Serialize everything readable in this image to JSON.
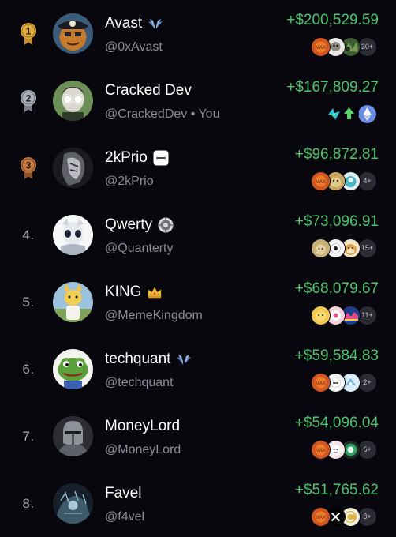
{
  "leaderboard": {
    "rows": [
      {
        "rank": "1",
        "medal": "gold",
        "name": "Avast",
        "badge": "wings-icon",
        "handle": "@0xAvast",
        "pnl": "+$200,529.59",
        "tokens": [
          "orange",
          "white",
          "camo"
        ],
        "more": "30+"
      },
      {
        "rank": "2",
        "medal": "silver",
        "name": "Cracked Dev",
        "badge": "",
        "handle": "@CrackedDev • You",
        "pnl": "+$167,809.27",
        "tokens": [
          "cyan",
          "green-arrow",
          "ethereum"
        ],
        "more": ""
      },
      {
        "rank": "3",
        "medal": "bronze",
        "name": "2kPrio",
        "badge": "white-card-icon",
        "handle": "@2kPrio",
        "pnl": "+$96,872.81",
        "tokens": [
          "orange",
          "tan",
          "teal"
        ],
        "more": "4+"
      },
      {
        "rank": "4.",
        "medal": "",
        "name": "Qwerty",
        "badge": "gear-badge-icon",
        "handle": "@Quanterty",
        "pnl": "+$73,096.91",
        "tokens": [
          "tan",
          "white",
          "doge"
        ],
        "more": "15+"
      },
      {
        "rank": "5.",
        "medal": "",
        "name": "KING",
        "badge": "crown-icon",
        "handle": "@MemeKingdom",
        "pnl": "+$68,079.67",
        "tokens": [
          "yellow",
          "pink",
          "rainbow"
        ],
        "more": "11+"
      },
      {
        "rank": "6.",
        "medal": "",
        "name": "techquant",
        "badge": "wings-icon",
        "handle": "@techquant",
        "pnl": "+$59,584.83",
        "tokens": [
          "orange",
          "white",
          "lightblue"
        ],
        "more": "2+"
      },
      {
        "rank": "7.",
        "medal": "",
        "name": "MoneyLord",
        "badge": "",
        "handle": "@MoneyLord",
        "pnl": "+$54,096.04",
        "tokens": [
          "orange",
          "pink",
          "green-circle"
        ],
        "more": "6+"
      },
      {
        "rank": "8.",
        "medal": "",
        "name": "Favel",
        "badge": "",
        "handle": "@f4vel",
        "pnl": "+$51,765.62",
        "tokens": [
          "orange",
          "x-logo",
          "gold-coin"
        ],
        "more": "8+"
      }
    ]
  },
  "colors": {
    "background": "#07070d",
    "pnl_green": "#4fc36b",
    "handle_gray": "#8a8c96",
    "gold": "#d9a43a",
    "silver": "#9ea3ab",
    "bronze": "#b9703f"
  }
}
